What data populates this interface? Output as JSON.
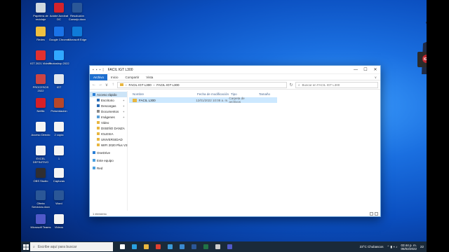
{
  "desktop": {
    "icons": [
      {
        "label": "Papelera de reciclaje",
        "color": "#cfd8e0"
      },
      {
        "label": "Adobe Acrobat DC",
        "color": "#d4232b"
      },
      {
        "label": "Resolución Consejo.docx",
        "color": "#2b5797"
      },
      {
        "label": "Redes",
        "color": "#f0c040"
      },
      {
        "label": "Google Chrome",
        "color": "#1a73e8"
      },
      {
        "label": "Microsoft Edge",
        "color": "#0f7bd8"
      },
      {
        "label": "IGT 2021 Videos",
        "color": "#e03030"
      },
      {
        "label": "Photoshop 2022",
        "color": "#31a8ff"
      },
      {
        "label": "PROCESOS 2022",
        "color": "#c44"
      },
      {
        "label": "IGT",
        "color": "#e0e6ee"
      },
      {
        "label": "Netflix",
        "color": "#d81f26"
      },
      {
        "label": "Presentación",
        "color": "#b7472a"
      },
      {
        "label": "Acceso Directo",
        "color": "#f4f4f4"
      },
      {
        "label": "2 copia",
        "color": "#f4f4f4"
      },
      {
        "label": "EXCEL DEFINITIVO",
        "color": "#f4f4f4"
      },
      {
        "label": "1",
        "color": "#f4f4f4"
      },
      {
        "label": "OBS Studio",
        "color": "#302e31"
      },
      {
        "label": "Capturas",
        "color": "#f4f4f4"
      },
      {
        "label": "Oferta Servicios.docx",
        "color": "#2b5797"
      },
      {
        "label": "Word",
        "color": "#2b5797"
      },
      {
        "label": "Microsoft Teams",
        "color": "#5059c9"
      },
      {
        "label": "Videos",
        "color": "#f4f4f4"
      }
    ]
  },
  "explorer": {
    "title": "FACIL IGT L300",
    "quick_access": [
      "▪",
      "▪",
      "▪",
      "|"
    ],
    "ribbon_tabs": [
      "Archivo",
      "Inicio",
      "Compartir",
      "Vista"
    ],
    "nav_back": "←",
    "nav_forward": "→",
    "nav_recent": "∨",
    "nav_up": "↑",
    "refresh": "↻",
    "address": [
      "FACIL IGT L300",
      "FACIL IGT L300"
    ],
    "address_sep": "›",
    "search_placeholder": "Buscar en FACIL IGT L300",
    "sidebar": [
      {
        "label": "Acceso rápido",
        "indent": false,
        "selected": true,
        "pin": false,
        "color": "#2a7fd6"
      },
      {
        "label": "Escritorio",
        "indent": true,
        "pin": true,
        "color": "#2a6cb5"
      },
      {
        "label": "Descargas",
        "indent": true,
        "pin": true,
        "color": "#2a6cb5"
      },
      {
        "label": "Documentos",
        "indent": true,
        "pin": true,
        "color": "#8a8a8a"
      },
      {
        "label": "Imágenes",
        "indent": true,
        "pin": true,
        "color": "#5aa0d8"
      },
      {
        "label": "Video",
        "indent": true,
        "pin": false,
        "color": "#e8b640"
      },
      {
        "label": "DISEÑO DANZA",
        "indent": true,
        "pin": false,
        "color": "#e8b640"
      },
      {
        "label": "IGLESIA",
        "indent": true,
        "pin": false,
        "color": "#e8b640"
      },
      {
        "label": "UNIVERSIDAD",
        "indent": true,
        "pin": false,
        "color": "#e8b640"
      },
      {
        "label": "WIFI 2020 Plus V3",
        "indent": true,
        "pin": false,
        "color": "#e8b640"
      },
      {
        "label": "OneDrive",
        "indent": false,
        "pin": false,
        "color": "#2a7fd6",
        "gap": true
      },
      {
        "label": "Este equipo",
        "indent": false,
        "pin": false,
        "color": "#4aa0e0",
        "gap": true
      },
      {
        "label": "Red",
        "indent": false,
        "pin": false,
        "color": "#4aa0e0",
        "gap": true
      }
    ],
    "pin_glyph": "✦",
    "columns": [
      "Nombre",
      "Fecha de modificación",
      "Tipo",
      "Tamaño"
    ],
    "files": [
      {
        "name": "FACIL L300",
        "modified": "12/01/2022 10:08 a. m.",
        "type": "Carpeta de archivos",
        "size": ""
      }
    ],
    "status": "1 elemento",
    "window_buttons": [
      "—",
      "☐",
      "✕"
    ],
    "expand": "∨"
  },
  "avatar": {
    "badge": "IGT"
  },
  "taskbar": {
    "search_placeholder": "Escribe aquí para buscar",
    "pinned": [
      {
        "name": "task-view",
        "color": "#ffffff"
      },
      {
        "name": "edge",
        "color": "#2aa0e0"
      },
      {
        "name": "explorer",
        "color": "#e8b640"
      },
      {
        "name": "chrome",
        "color": "#e04030"
      },
      {
        "name": "photos",
        "color": "#3a9ad9"
      },
      {
        "name": "store",
        "color": "#3a8ad0"
      },
      {
        "name": "word",
        "color": "#2b5797"
      },
      {
        "name": "excel",
        "color": "#217346"
      },
      {
        "name": "obs",
        "color": "#cccccc"
      },
      {
        "name": "teams",
        "color": "#5059c9"
      }
    ],
    "weather": "23°C  Chubascos",
    "time": "03:44 p. m.",
    "date": "05/02/2022",
    "badge": "22"
  }
}
